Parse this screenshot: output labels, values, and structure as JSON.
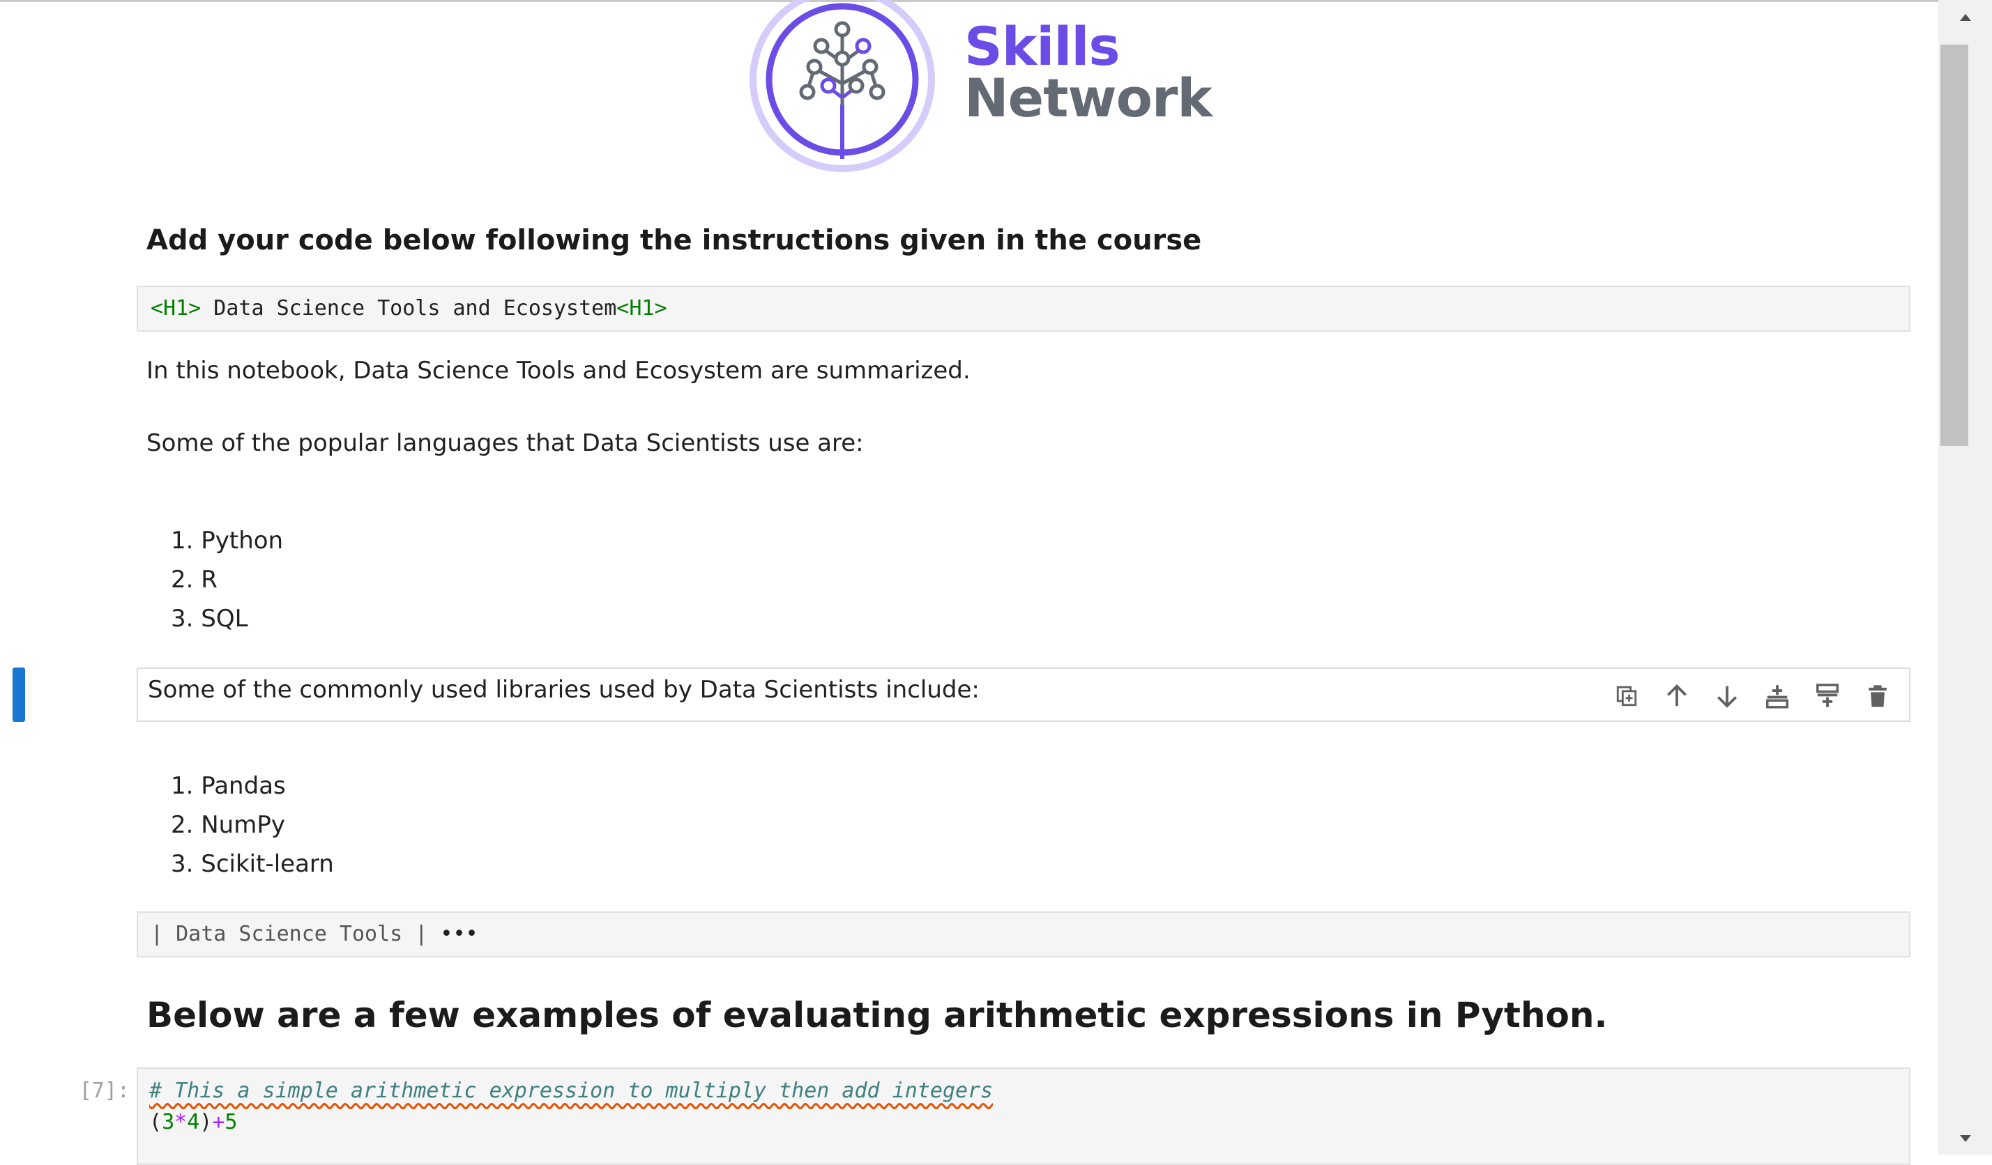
{
  "logo": {
    "word1": "Skills",
    "word2": "Network",
    "colors": {
      "purple": "#6b4ce6",
      "gray": "#636a73",
      "ring": "#d6ccfb"
    }
  },
  "cells": {
    "instructions_heading": "Add your code below following the instructions given in the course",
    "raw_title": {
      "open_tag": "<H1>",
      "text": " Data Science Tools and Ecosystem",
      "close_tag": "<H1>"
    },
    "intro": "In this notebook, Data Science Tools and Ecosystem are summarized.",
    "languages_intro": "Some of the popular languages that Data Scientists use are:",
    "languages": [
      "1. Python",
      "2. R",
      "3. SQL"
    ],
    "libraries_intro": "Some of the commonly used libraries used by Data Scientists include:",
    "libraries": [
      "1. Pandas",
      "2. NumPy",
      "3. Scikit-learn"
    ],
    "table_raw": "| Data Science Tools |",
    "table_more": "•••",
    "arith_heading": "Below are a few examples of evaluating arithmetic expressions in Python.",
    "code_prompt": "[7]:",
    "code_comment": "# This a simple arithmetic expression to multiply then add integers",
    "code_line": {
      "open": "(",
      "a": "3",
      "op1": "*",
      "b": "4",
      "close": ")",
      "op2": "+",
      "c": "5"
    }
  },
  "toolbar": {
    "icons": [
      "duplicate-icon",
      "move-up-icon",
      "move-down-icon",
      "insert-below-icon",
      "insert-above-icon",
      "delete-icon"
    ]
  },
  "colors": {
    "selection": "#1976d2",
    "cell_bg": "#f5f5f5",
    "cell_border": "#e0e0e0"
  }
}
